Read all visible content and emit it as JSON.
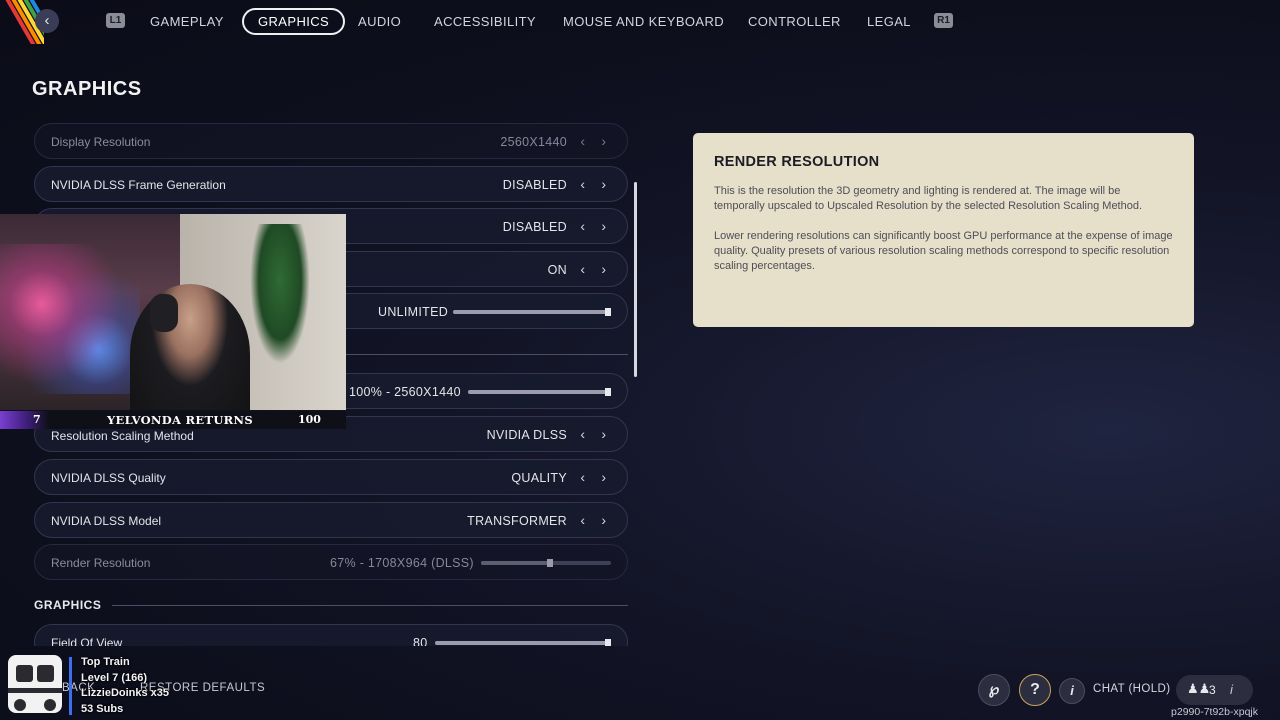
{
  "nav": {
    "bumper_left": "L1",
    "bumper_right": "R1",
    "tabs": [
      {
        "label": "GAMEPLAY"
      },
      {
        "label": "GRAPHICS",
        "active": true
      },
      {
        "label": "AUDIO"
      },
      {
        "label": "ACCESSIBILITY"
      },
      {
        "label": "MOUSE AND KEYBOARD"
      },
      {
        "label": "CONTROLLER"
      },
      {
        "label": "LEGAL"
      }
    ]
  },
  "page_title": "GRAPHICS",
  "settings": {
    "display_resolution": {
      "label": "Display Resolution",
      "value": "2560X1440",
      "disabled": true
    },
    "frame_generation": {
      "label": "NVIDIA DLSS Frame Generation",
      "value": "DISABLED"
    },
    "row3": {
      "value": "DISABLED"
    },
    "row4": {
      "value": "ON"
    },
    "row5": {
      "value": "UNLIMITED",
      "fill": 1.0
    },
    "row6": {
      "value": "100% - 2560X1440",
      "fill": 1.0
    },
    "scaling_method": {
      "label": "Resolution Scaling Method",
      "value": "NVIDIA DLSS"
    },
    "dlss_quality": {
      "label": "NVIDIA DLSS Quality",
      "value": "QUALITY"
    },
    "dlss_model": {
      "label": "NVIDIA DLSS Model",
      "value": "TRANSFORMER"
    },
    "render_resolution": {
      "label": "Render Resolution",
      "value": "67% - 1708X964 (DLSS)",
      "fill": 0.55,
      "disabled": true
    },
    "section_graphics": "GRAPHICS",
    "fov": {
      "label": "Field Of View",
      "value": "80",
      "fill": 1.0
    }
  },
  "info_panel": {
    "title": "RENDER RESOLUTION",
    "paragraph1": "This is the resolution the 3D geometry and lighting is rendered at. The image will be temporally upscaled to Upscaled Resolution by the selected Resolution Scaling Method.",
    "paragraph2": "Lower rendering resolutions can significantly boost GPU performance at the expense of image quality. Quality presets of various resolution scaling methods correspond to specific resolution scaling percentages."
  },
  "webcam": {
    "level": "7",
    "name": "YELVONDA RETURNS",
    "count": "100"
  },
  "bottom": {
    "back_label": "BACK",
    "restore_label": "RESTORE DEFAULTS",
    "train_line1": "Top Train",
    "train_line2": "Level 7 (166)",
    "train_line3": "LizzieDoinks x35",
    "train_line4": "53 Subs",
    "chat_label": "CHAT (HOLD)",
    "party_count": "3",
    "user_code": "p2990-7t92b-xpqjk"
  },
  "icons": {
    "back": "chevron-left-icon",
    "chevron_left": "chevron-left-icon",
    "chevron_right": "chevron-right-icon",
    "help": "question-icon",
    "info": "info-icon",
    "party": "people-icon"
  }
}
